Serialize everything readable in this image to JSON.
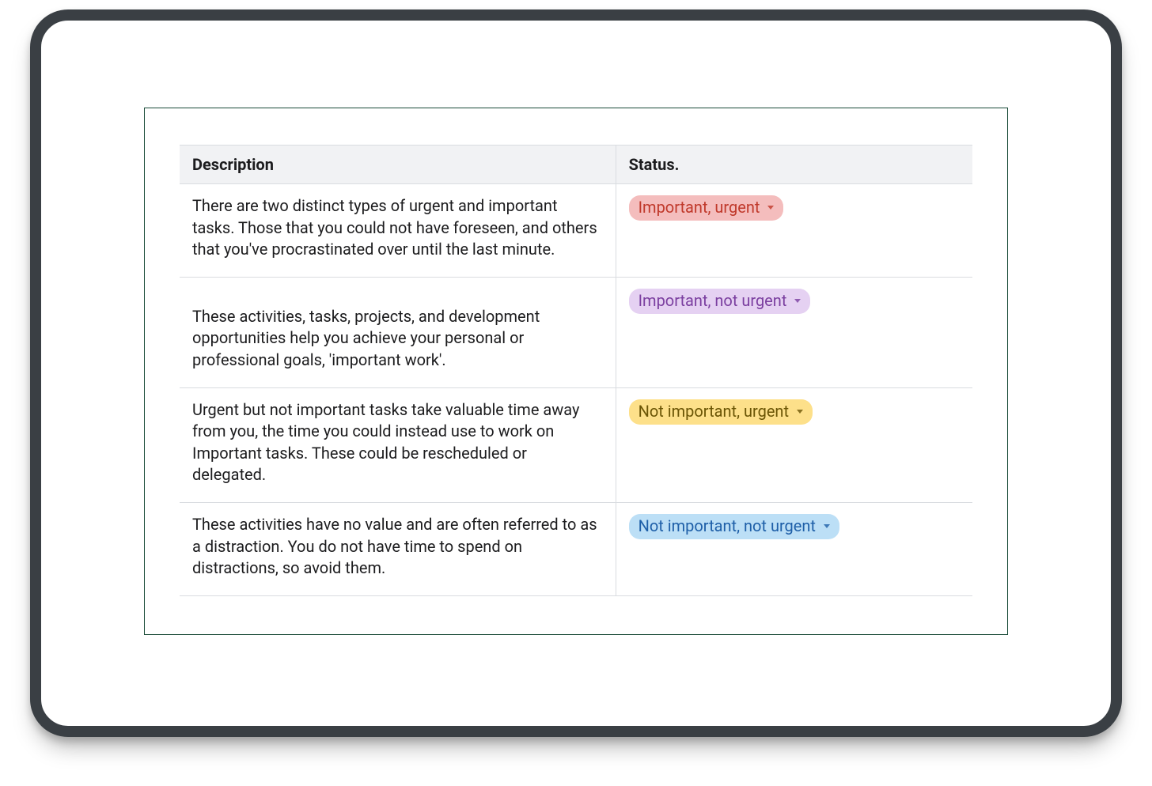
{
  "table": {
    "headers": {
      "description": "Description",
      "status": "Status."
    },
    "rows": [
      {
        "description": "There are two distinct types of urgent and important tasks. Those that you could not have foreseen, and others that you've procrastinated over until the last minute.",
        "status": {
          "label": "Important, urgent",
          "bg": "#f4bdbd",
          "fg": "#c0392b"
        }
      },
      {
        "description": "These activities, tasks, projects, and development opportunities help you achieve your personal or professional goals, 'important work'.",
        "status": {
          "label": "Important, not urgent",
          "bg": "#e5d1f2",
          "fg": "#7b3fa0"
        }
      },
      {
        "description": "Urgent but not important tasks take valuable time away from you, the time you could instead use to work on Important tasks. These could be rescheduled or delegated.",
        "status": {
          "label": "Not important, urgent",
          "bg": "#fde08a",
          "fg": "#6b5505"
        }
      },
      {
        "description": "These activities have no value and are often referred to as a distraction. You do not have time to spend on distractions, so avoid them.",
        "status": {
          "label": "Not important, not urgent",
          "bg": "#bcdff6",
          "fg": "#1e5fa8"
        }
      }
    ]
  }
}
